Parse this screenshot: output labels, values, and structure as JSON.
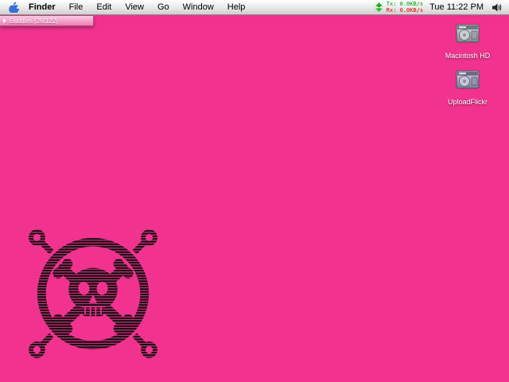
{
  "menu_bar": {
    "items": [
      "Finder",
      "File",
      "Edit",
      "View",
      "Go",
      "Window",
      "Help"
    ],
    "status": {
      "tx": "Tx:  0.0KB/s",
      "rx": "Rx:  0.0KB/s",
      "clock": "Tue 11:22 PM"
    }
  },
  "buddies_window": {
    "title": "Buddies (26/122)"
  },
  "desktop": {
    "icons": [
      {
        "label": "Macintosh HD"
      },
      {
        "label": "UploadFlickr"
      }
    ]
  },
  "colors": {
    "desktop_pink": "#F1338F",
    "tx_green": "#00A000",
    "rx_red": "#D40000",
    "skull_black": "#0c0c0c"
  }
}
